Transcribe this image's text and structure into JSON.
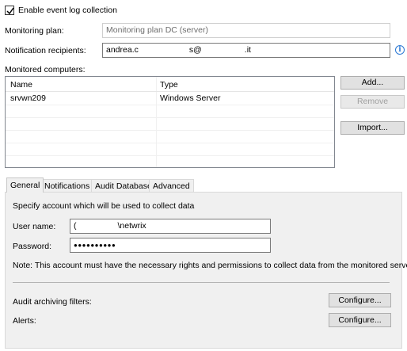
{
  "enable_checkbox": {
    "label": "Enable event log collection",
    "checked": true
  },
  "monitoring_plan": {
    "label": "Monitoring plan:",
    "value": "Monitoring plan DC (server)"
  },
  "notification": {
    "label": "Notification recipients:",
    "value_prefix": "andrea.c",
    "value_mid": "s@",
    "value_suffix": ".it",
    "info_icon": "info-icon"
  },
  "monitored": {
    "label": "Monitored computers:",
    "columns": [
      "Name",
      "Type"
    ],
    "rows": [
      {
        "name": "srvwn209",
        "type": "Windows Server"
      }
    ]
  },
  "side_buttons": {
    "add": "Add...",
    "remove": "Remove",
    "import": "Import..."
  },
  "tabs": [
    "General",
    "Notifications",
    "Audit Database",
    "Advanced"
  ],
  "general": {
    "intro": "Specify account which will be used to collect data",
    "username_label": "User name:",
    "username_prefix": "(",
    "username_suffix": "\\netwrix",
    "password_label": "Password:",
    "password_mask": "●●●●●●●●●●",
    "note": "Note: This account must have the necessary rights and permissions to collect data from the monitored servers.",
    "archiving_label": "Audit archiving filters:",
    "alerts_label": "Alerts:",
    "configure_label": "Configure..."
  }
}
